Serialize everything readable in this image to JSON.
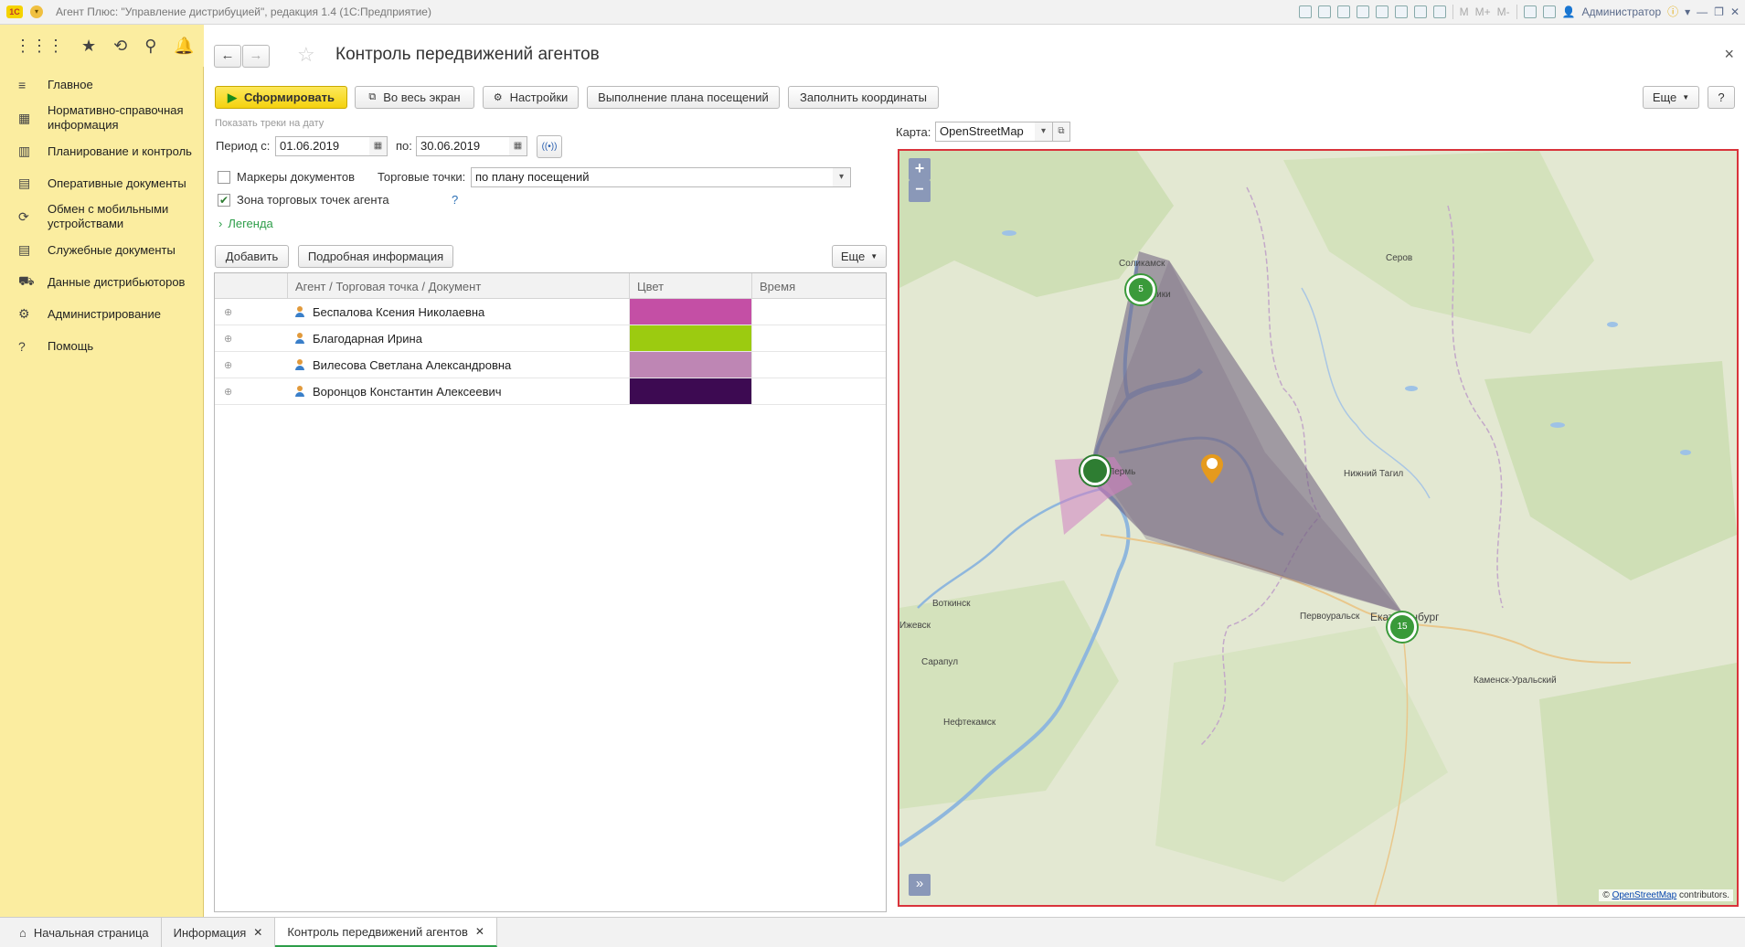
{
  "window": {
    "title": "Агент Плюс: \"Управление дистрибуцией\", редакция 1.4  (1С:Предприятие)",
    "logo": "1С",
    "user": "Администратор",
    "m_buttons": [
      "M",
      "M+",
      "M-"
    ]
  },
  "sidebar": {
    "items": [
      {
        "icon": "menu-lines-icon",
        "glyph": "≡",
        "label": "Главное"
      },
      {
        "icon": "reference-book-icon",
        "glyph": "▦",
        "label": "Нормативно-справочная информация"
      },
      {
        "icon": "bar-chart-icon",
        "glyph": "▥",
        "label": "Планирование и контроль"
      },
      {
        "icon": "documents-icon",
        "glyph": "▤",
        "label": "Оперативные документы"
      },
      {
        "icon": "sync-icon",
        "glyph": "⟳",
        "label": "Обмен с мобильными устройствами"
      },
      {
        "icon": "service-docs-icon",
        "glyph": "▤",
        "label": "Служебные документы"
      },
      {
        "icon": "distributor-data-icon",
        "glyph": "⛟",
        "label": "Данные дистрибьюторов"
      },
      {
        "icon": "gear-icon",
        "glyph": "⚙",
        "label": "Администрирование"
      },
      {
        "icon": "help-icon",
        "glyph": "?",
        "label": "Помощь"
      }
    ]
  },
  "page": {
    "title": "Контроль передвижений агентов"
  },
  "toolbar": {
    "generate": "Сформировать",
    "fullscreen": "Во весь экран",
    "settings": "Настройки",
    "plan": "Выполнение плана посещений",
    "fill_coords": "Заполнить координаты",
    "more": "Еще",
    "help": "?"
  },
  "filters": {
    "tracks_label": "Показать треки на дату",
    "period_from_label": "Период с:",
    "period_from": "01.06.2019",
    "period_to_label": "по:",
    "period_to": "30.06.2019",
    "doc_markers_label": "Маркеры документов",
    "doc_markers_checked": false,
    "trade_points_label": "Торговые точки:",
    "trade_points_value": "по плану посещений",
    "zone_label": "Зона торговых точек агента",
    "zone_checked": true,
    "zone_help": "?",
    "legend": "Легенда"
  },
  "table_toolbar": {
    "add": "Добавить",
    "details": "Подробная информация",
    "more": "Еще"
  },
  "table": {
    "columns": [
      "Агент / Торговая точка / Документ",
      "Цвет",
      "Время"
    ],
    "rows": [
      {
        "name": "Беспалова Ксения Николаевна",
        "color": "#c44fa5",
        "time": ""
      },
      {
        "name": "Благодарная Ирина",
        "color": "#9ccb10",
        "time": ""
      },
      {
        "name": "Вилесова Светлана Александровна",
        "color": "#be86b4",
        "time": ""
      },
      {
        "name": "Воронцов Константин Алексеевич",
        "color": "#3d0a52",
        "time": ""
      }
    ]
  },
  "map": {
    "label": "Карта:",
    "provider": "OpenStreetMap",
    "zoom_in": "+",
    "zoom_out": "−",
    "expand": "»",
    "cities": [
      "Соликамск",
      "Березники",
      "Серов",
      "Пермь",
      "Нижний Тагил",
      "Воткинск",
      "Первоуральск",
      "Екатеринбург",
      "Сарапул",
      "Нефтекамск",
      "Каменск-Уральский",
      "Ижевск"
    ],
    "clusters": [
      "5",
      "15"
    ],
    "attribution_prefix": "©",
    "attribution_link": "OpenStreetMap",
    "attribution_suffix": "contributors."
  },
  "tabs": [
    {
      "label": "Начальная страница",
      "icon": "home-icon"
    },
    {
      "label": "Информация",
      "icon": ""
    },
    {
      "label": "Контроль передвижений агентов",
      "icon": ""
    }
  ]
}
